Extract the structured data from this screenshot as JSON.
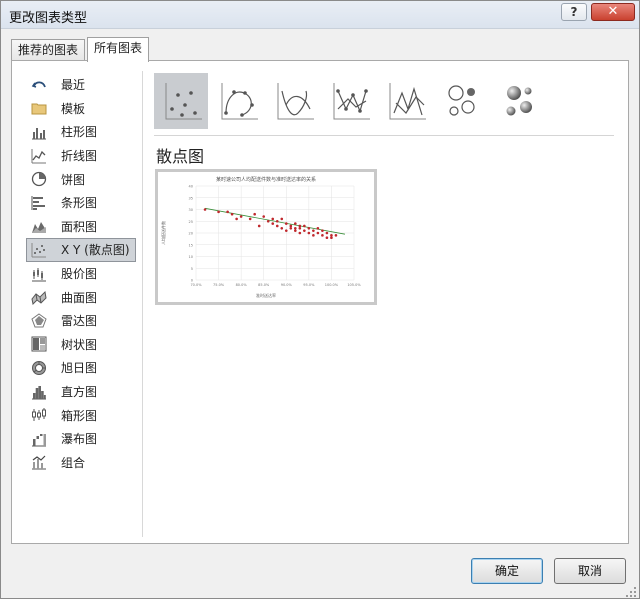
{
  "window": {
    "title": "更改图表类型",
    "help_label": "?",
    "close_label": "✕"
  },
  "tabs": [
    {
      "label": "推荐的图表",
      "active": false
    },
    {
      "label": "所有图表",
      "active": true
    }
  ],
  "sidebar": {
    "items": [
      {
        "label": "最近",
        "icon": "undo-arrow-icon"
      },
      {
        "label": "模板",
        "icon": "folder-icon"
      },
      {
        "label": "柱形图",
        "icon": "column-chart-icon"
      },
      {
        "label": "折线图",
        "icon": "line-chart-icon"
      },
      {
        "label": "饼图",
        "icon": "pie-chart-icon"
      },
      {
        "label": "条形图",
        "icon": "bar-chart-icon"
      },
      {
        "label": "面积图",
        "icon": "area-chart-icon"
      },
      {
        "label": "X Y (散点图)",
        "icon": "scatter-chart-icon",
        "selected": true
      },
      {
        "label": "股价图",
        "icon": "stock-chart-icon"
      },
      {
        "label": "曲面图",
        "icon": "surface-chart-icon"
      },
      {
        "label": "雷达图",
        "icon": "radar-chart-icon"
      },
      {
        "label": "树状图",
        "icon": "treemap-chart-icon"
      },
      {
        "label": "旭日图",
        "icon": "sunburst-chart-icon"
      },
      {
        "label": "直方图",
        "icon": "histogram-chart-icon"
      },
      {
        "label": "箱形图",
        "icon": "box-whisker-chart-icon"
      },
      {
        "label": "瀑布图",
        "icon": "waterfall-chart-icon"
      },
      {
        "label": "组合",
        "icon": "combo-chart-icon"
      }
    ]
  },
  "subtypes": [
    {
      "icon": "scatter-markers-icon",
      "selected": true
    },
    {
      "icon": "scatter-smooth-lines-markers-icon"
    },
    {
      "icon": "scatter-smooth-lines-icon"
    },
    {
      "icon": "scatter-straight-lines-markers-icon"
    },
    {
      "icon": "scatter-straight-lines-icon"
    },
    {
      "icon": "bubble-icon"
    },
    {
      "icon": "bubble-3d-icon"
    }
  ],
  "section_title": "散点图",
  "preview": {
    "title": "某时速公司人均配送件数与准时送达率的关系",
    "ylabel": "人均配送件数",
    "xlabel": "准时送达率",
    "ytick_labels": [
      "40",
      "35",
      "30",
      "25",
      "20",
      "15",
      "10",
      "5",
      "0"
    ],
    "xtick_labels": [
      "70.0%",
      "75.0%",
      "80.0%",
      "85.0%",
      "90.0%",
      "95.0%",
      "100.0%",
      "105.0%"
    ],
    "colors": {
      "points": "#c0282d",
      "trend": "#3a8f3a",
      "grid": "#e3e3e3"
    }
  },
  "chart_data": {
    "type": "scatter",
    "title": "某时速公司人均配送件数与准时送达率的关系",
    "xlabel": "准时送达率",
    "ylabel": "人均配送件数",
    "xlim": [
      0.7,
      1.05
    ],
    "ylim": [
      0,
      40
    ],
    "grid": true,
    "series": [
      {
        "x": [
          0.72,
          0.75,
          0.77,
          0.78,
          0.79,
          0.8,
          0.82,
          0.83,
          0.84,
          0.85,
          0.86,
          0.87,
          0.87,
          0.88,
          0.88,
          0.89,
          0.89,
          0.9,
          0.9,
          0.91,
          0.91,
          0.92,
          0.92,
          0.92,
          0.93,
          0.93,
          0.93,
          0.94,
          0.94,
          0.95,
          0.95,
          0.96,
          0.96,
          0.97,
          0.97,
          0.98,
          0.98,
          0.99,
          0.99,
          1.0,
          1.0,
          1.01
        ],
        "y": [
          30,
          29,
          29,
          28,
          26,
          27,
          26,
          28,
          23,
          27,
          25,
          26,
          24,
          25,
          23,
          26,
          22,
          24,
          21,
          23,
          22,
          24,
          22,
          21,
          23,
          20,
          22,
          21,
          23,
          20,
          22,
          21,
          19,
          22,
          20,
          19,
          21,
          18,
          20,
          19,
          18,
          19
        ]
      }
    ],
    "trendline": {
      "x": [
        0.72,
        1.03
      ],
      "y": [
        30.5,
        19.5
      ]
    }
  },
  "buttons": {
    "ok": "确定",
    "cancel": "取消"
  }
}
